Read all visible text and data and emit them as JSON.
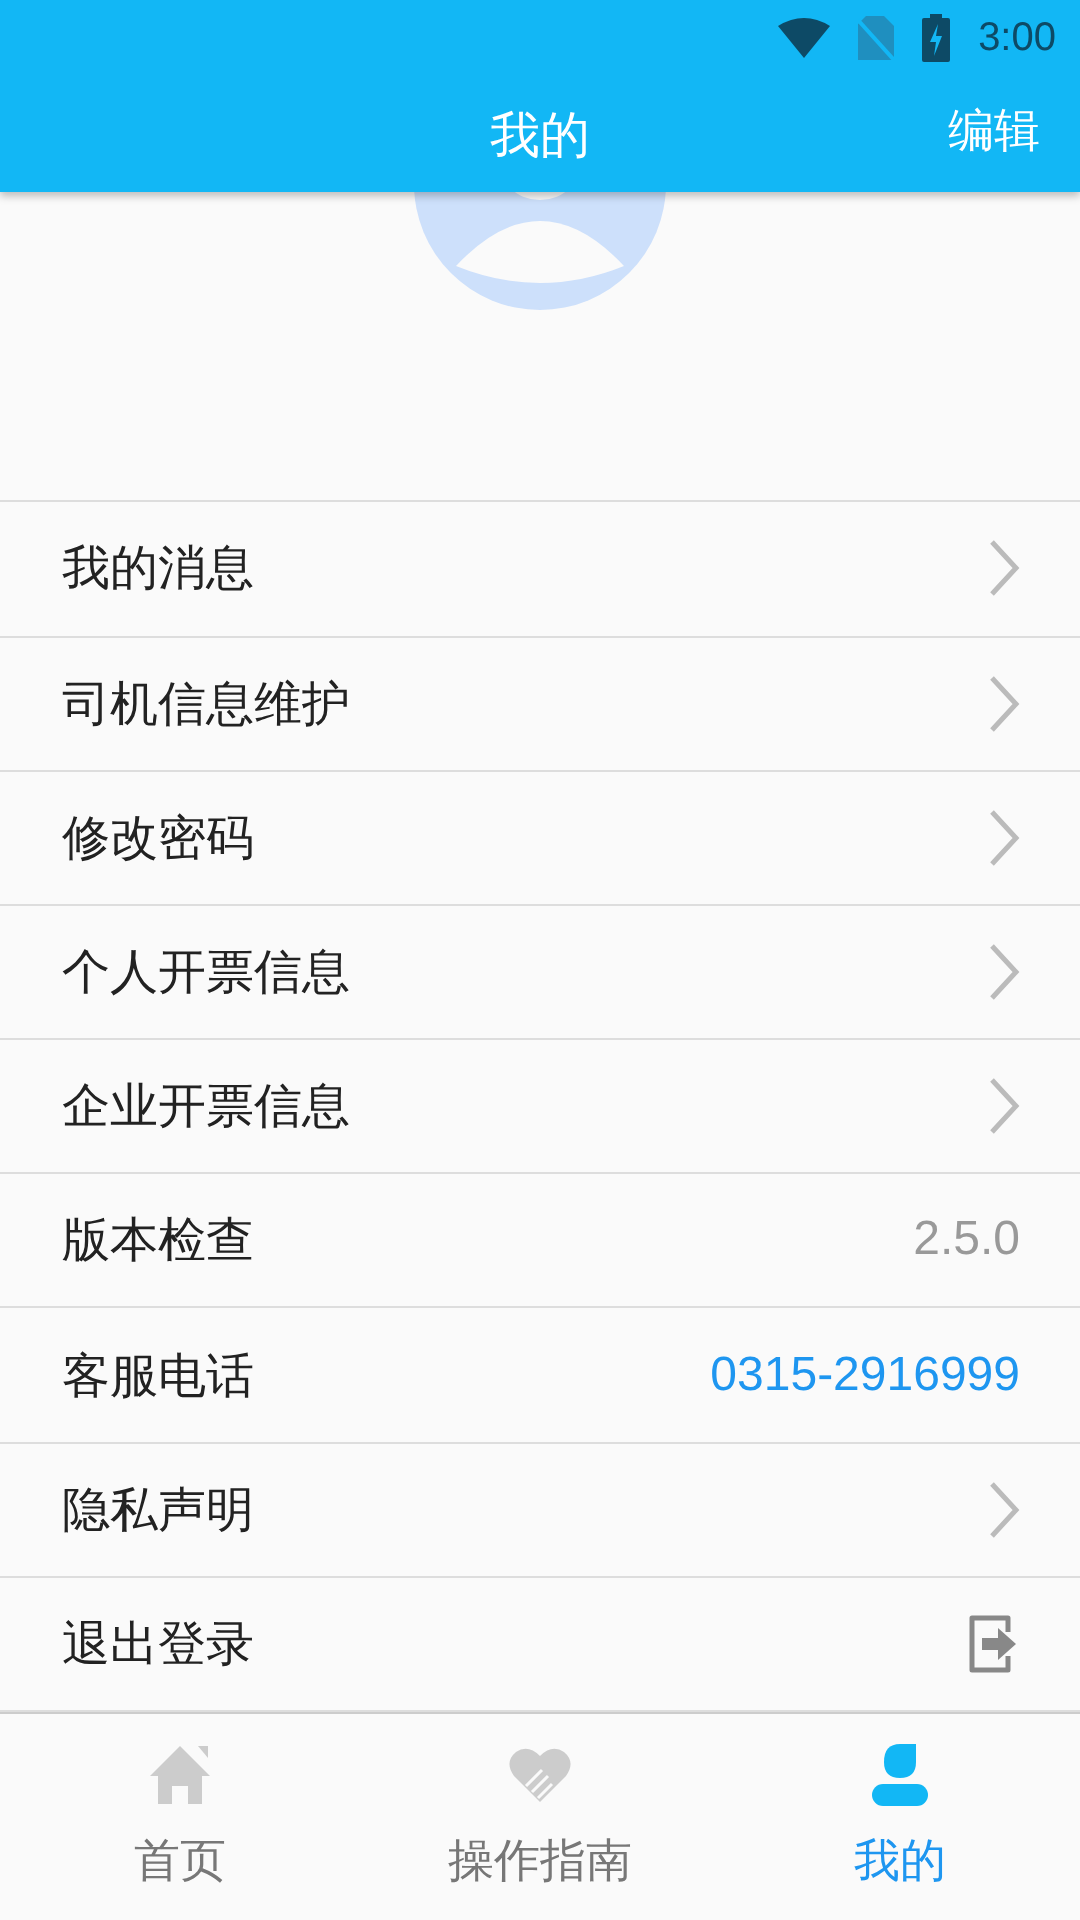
{
  "status_bar": {
    "time": "3:00"
  },
  "header": {
    "title": "我的",
    "action": "编辑"
  },
  "menu": [
    {
      "label": "我的消息",
      "kind": "arrow"
    },
    {
      "label": "司机信息维护",
      "kind": "arrow"
    },
    {
      "label": "修改密码",
      "kind": "arrow"
    },
    {
      "label": "个人开票信息",
      "kind": "arrow"
    },
    {
      "label": "企业开票信息",
      "kind": "arrow"
    },
    {
      "label": "版本检查",
      "kind": "value",
      "value": "2.5.0"
    },
    {
      "label": "客服电话",
      "kind": "phone",
      "value": "0315-2916999"
    },
    {
      "label": "隐私声明",
      "kind": "arrow"
    },
    {
      "label": "退出登录",
      "kind": "logout"
    }
  ],
  "tabs": [
    {
      "label": "首页",
      "kind": "home",
      "selected": false
    },
    {
      "label": "操作指南",
      "kind": "guide",
      "selected": false
    },
    {
      "label": "我的",
      "kind": "profile",
      "selected": true
    }
  ]
}
